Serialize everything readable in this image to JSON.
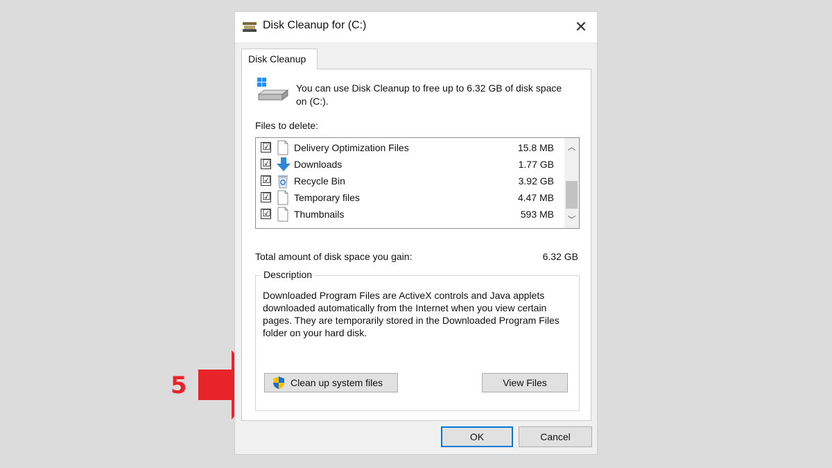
{
  "annotation": {
    "step": "5",
    "arrow_color": "#e8242b"
  },
  "dialog": {
    "title": "Disk Cleanup for  (C:)",
    "tab_label": "Disk Cleanup",
    "info_text": "You can use Disk Cleanup to free up to 6.32 GB of disk space on  (C:).",
    "files_label": "Files to delete:",
    "files": [
      {
        "name": "Delivery Optimization Files",
        "size": "15.8 MB",
        "checked": "☑",
        "icon": "file-icon"
      },
      {
        "name": "Downloads",
        "size": "1.77 GB",
        "checked": "☑",
        "icon": "download-arrow-icon"
      },
      {
        "name": "Recycle Bin",
        "size": "3.92 GB",
        "checked": "☑",
        "icon": "recycle-bin-icon"
      },
      {
        "name": "Temporary files",
        "size": "4.47 MB",
        "checked": "☑",
        "icon": "file-icon"
      },
      {
        "name": "Thumbnails",
        "size": "593 MB",
        "checked": "☑",
        "icon": "file-icon"
      }
    ],
    "total_label": "Total amount of disk space you gain:",
    "total_value": "6.32 GB",
    "description_legend": "Description",
    "description_text": "Downloaded Program Files are ActiveX controls and Java applets downloaded automatically from the Internet when you view certain pages. They are temporarily stored in the Downloaded Program Files folder on your hard disk.",
    "cleanup_button": "Clean up system files",
    "view_files_button": "View Files",
    "ok_button": "OK",
    "cancel_button": "Cancel",
    "close_glyph": "✕",
    "scroll_up_glyph": "︿",
    "scroll_down_glyph": "﹀"
  },
  "colors": {
    "accent": "#0078d7",
    "annotation": "#e8242b"
  }
}
